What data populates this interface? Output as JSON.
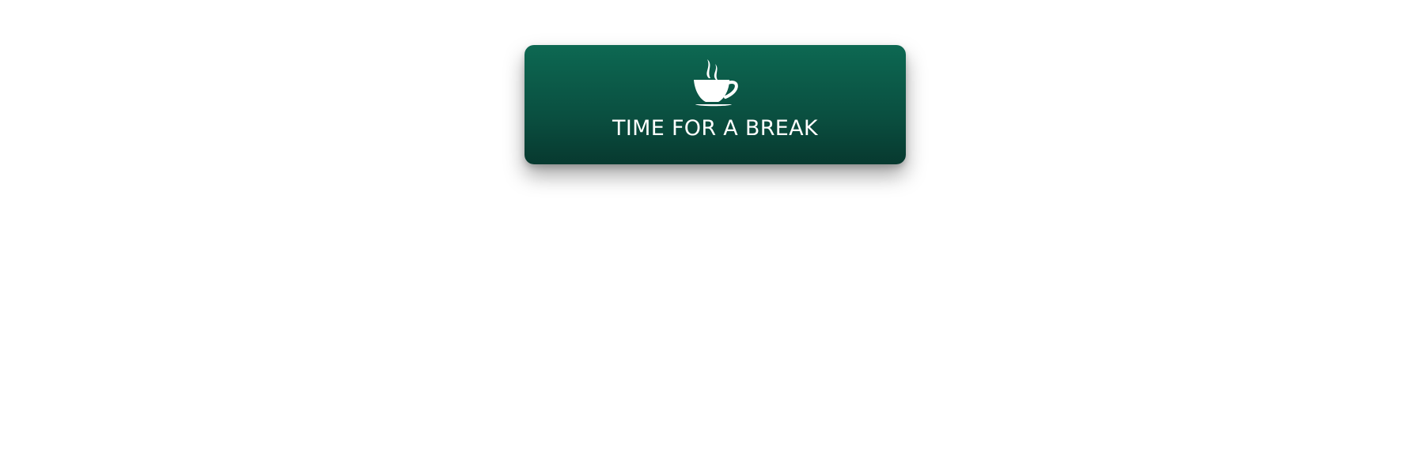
{
  "break_button": {
    "label": "TIME FOR A BREAK",
    "icon": "coffee-cup-icon",
    "colors": {
      "gradient_top": "#0d6852",
      "gradient_bottom": "#07392f",
      "text": "#ffffff"
    }
  }
}
